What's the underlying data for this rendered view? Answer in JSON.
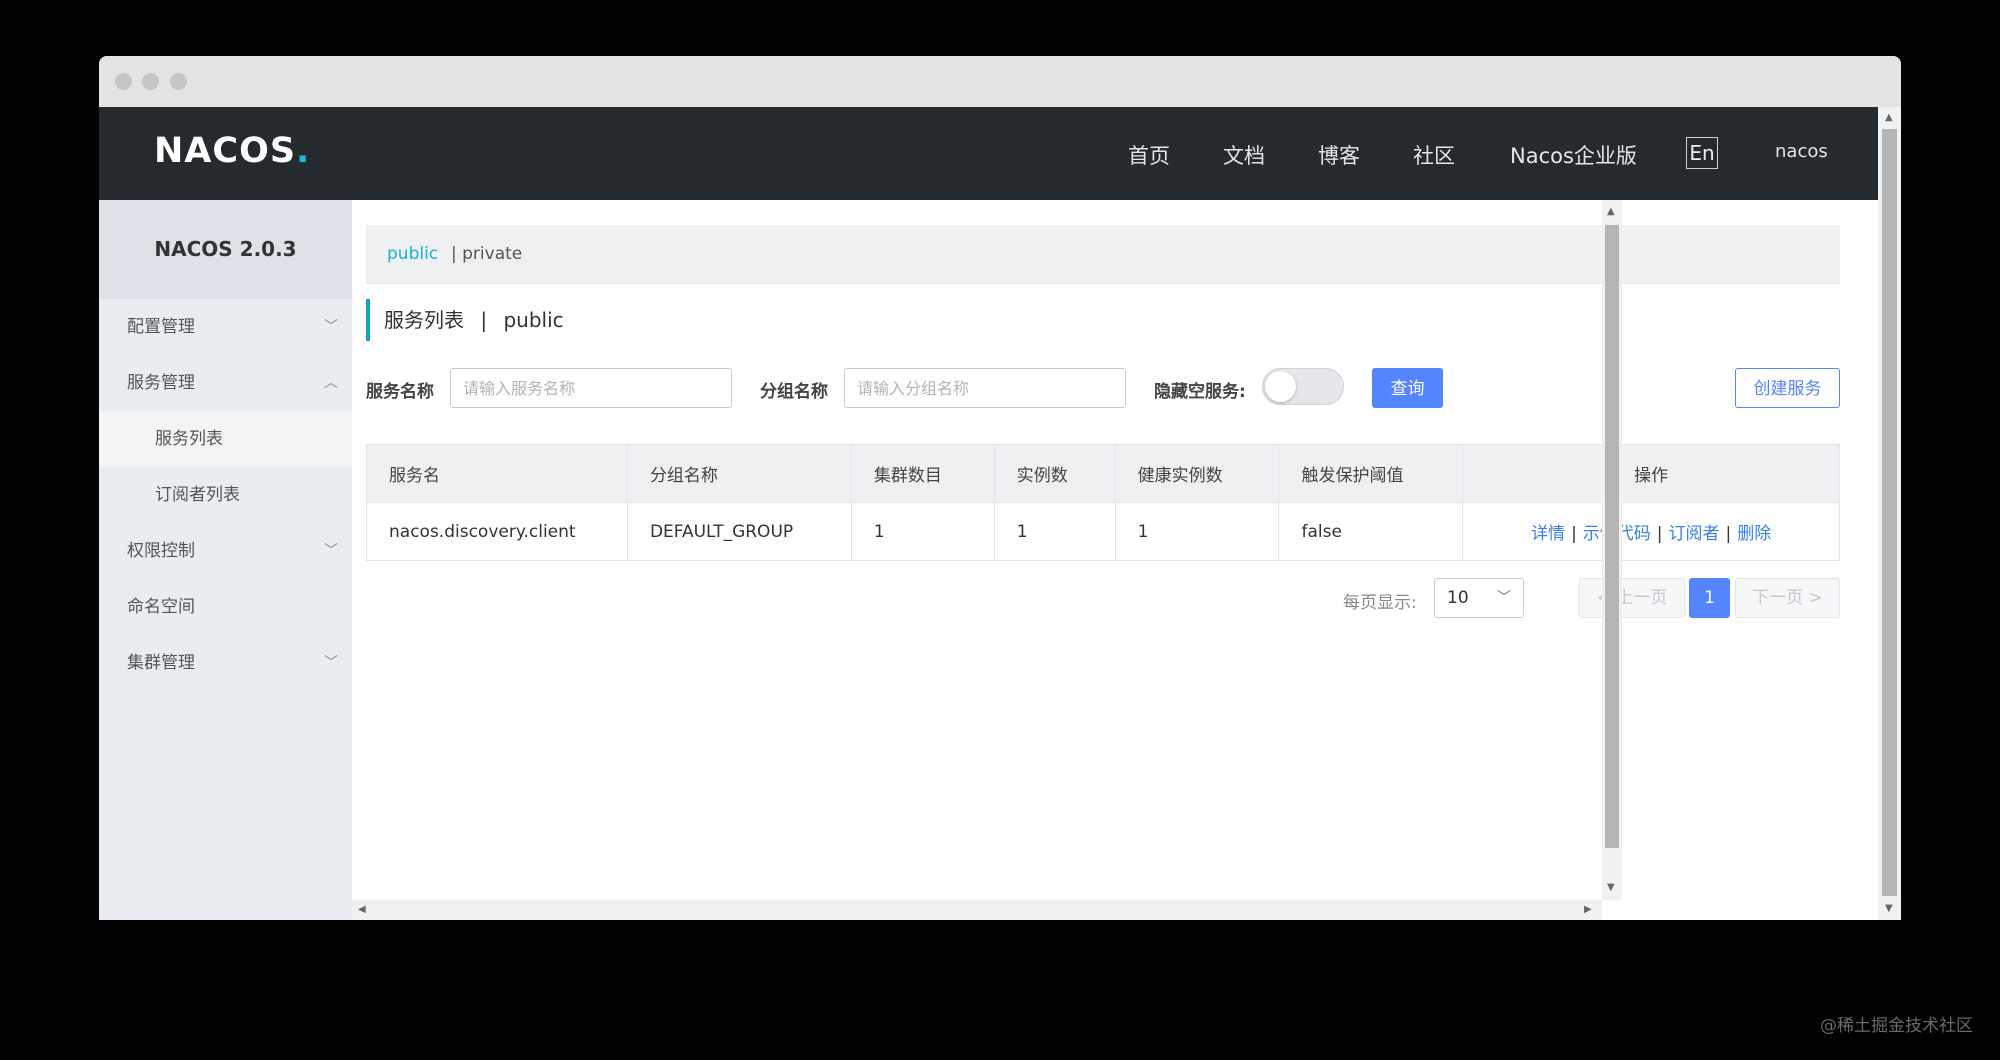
{
  "header": {
    "logo_text": "NACOS",
    "logo_dot": ".",
    "nav": [
      {
        "label": "首页"
      },
      {
        "label": "文档"
      },
      {
        "label": "博客"
      },
      {
        "label": "社区"
      },
      {
        "label": "Nacos企业版"
      }
    ],
    "lang": "En",
    "user": "nacos"
  },
  "sidebar": {
    "title": "NACOS 2.0.3",
    "items": [
      {
        "label": "配置管理",
        "chevron": "chevron-down-icon"
      },
      {
        "label": "服务管理",
        "chevron": "chevron-up-icon"
      },
      {
        "label": "服务列表",
        "active": true
      },
      {
        "label": "订阅者列表"
      },
      {
        "label": "权限控制",
        "chevron": "chevron-down-icon"
      },
      {
        "label": "命名空间"
      },
      {
        "label": "集群管理",
        "chevron": "chevron-down-icon"
      }
    ]
  },
  "namespaces": {
    "active": "public",
    "other": "| private"
  },
  "page": {
    "title_main": "服务列表",
    "title_sep": "|",
    "title_ns": "public"
  },
  "filters": {
    "service_label": "服务名称",
    "service_placeholder": "请输入服务名称",
    "group_label": "分组名称",
    "group_placeholder": "请输入分组名称",
    "hide_empty_label": "隐藏空服务:",
    "query_button": "查询",
    "create_button": "创建服务"
  },
  "table": {
    "columns": [
      "服务名",
      "分组名称",
      "集群数目",
      "实例数",
      "健康实例数",
      "触发保护阈值",
      "操作"
    ],
    "rows": [
      {
        "service": "nacos.discovery.client",
        "group": "DEFAULT_GROUP",
        "clusters": "1",
        "instances": "1",
        "healthy": "1",
        "threshold": "false",
        "ops": [
          "详情",
          "示例代码",
          "订阅者",
          "删除"
        ]
      }
    ],
    "op_sep": "|"
  },
  "pagination": {
    "page_size_label": "每页显示:",
    "page_size": "10",
    "prev": "上一页",
    "current": "1",
    "next": "下一页"
  },
  "watermark": "@稀土掘金技术社区"
}
